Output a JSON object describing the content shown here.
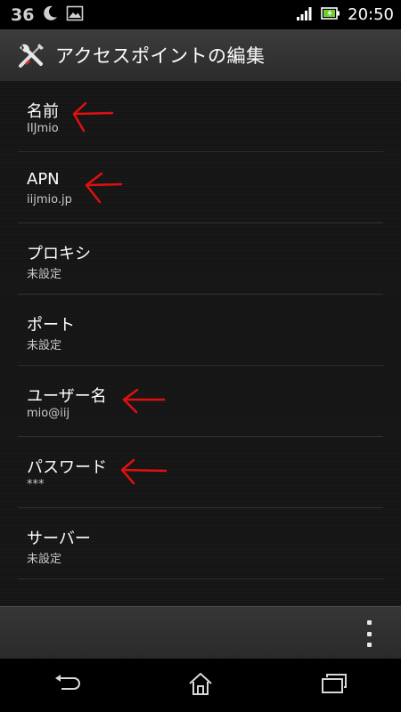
{
  "status_bar": {
    "left_number": "36",
    "icons": [
      "moon-icon",
      "picture-icon"
    ],
    "right_icons": [
      "signal-icon",
      "battery-icon"
    ],
    "time": "20:50"
  },
  "action_bar": {
    "icon": "tools-icon",
    "title": "アクセスポイントの編集"
  },
  "settings": [
    {
      "title": "名前",
      "summary": "IIJmio",
      "annotated": true
    },
    {
      "title": "APN",
      "summary": "iijmio.jp",
      "annotated": true
    },
    {
      "title": "プロキシ",
      "summary": "未設定",
      "annotated": false
    },
    {
      "title": "ポート",
      "summary": "未設定",
      "annotated": false
    },
    {
      "title": "ユーザー名",
      "summary": "mio@iij",
      "annotated": true
    },
    {
      "title": "パスワード",
      "summary": "***",
      "annotated": true
    },
    {
      "title": "サーバー",
      "summary": "未設定",
      "annotated": false
    }
  ],
  "bottom_bar": {
    "overflow_icon": "overflow-menu-icon"
  },
  "nav_bar": {
    "icons": [
      "back-icon",
      "home-icon",
      "recent-apps-icon"
    ]
  },
  "colors": {
    "annotation_arrow": "#e01010",
    "list_background": "#151515",
    "action_bar": "#333333"
  }
}
